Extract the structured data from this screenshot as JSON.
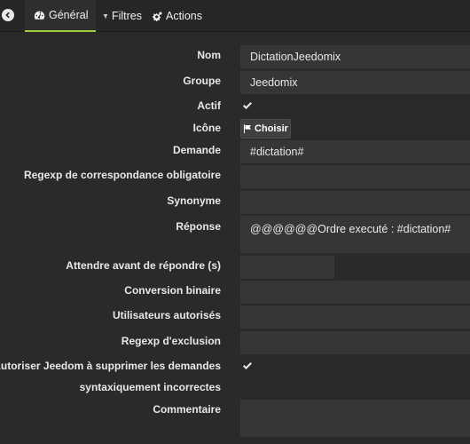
{
  "tabs": [
    {
      "label": "Général",
      "icon": "dashboard-icon",
      "active": true
    },
    {
      "label": "Filtres",
      "icon": "filter-icon",
      "active": false
    },
    {
      "label": "Actions",
      "icon": "cogs-icon",
      "active": false
    }
  ],
  "form": {
    "nom": {
      "label": "Nom",
      "value": "DictationJeedomix"
    },
    "groupe": {
      "label": "Groupe",
      "value": "Jeedomix"
    },
    "actif": {
      "label": "Actif",
      "checked": true
    },
    "icone": {
      "label": "Icône",
      "button_label": "Choisir"
    },
    "demande": {
      "label": "Demande",
      "value": "#dictation#"
    },
    "regexp_correspondance": {
      "label": "Regexp de correspondance obligatoire",
      "value": ""
    },
    "synonyme": {
      "label": "Synonyme",
      "value": ""
    },
    "reponse": {
      "label": "Réponse",
      "value": "@@@@@@Ordre executé : #dictation#"
    },
    "attendre": {
      "label": "Attendre avant de répondre (s)",
      "value": ""
    },
    "conversion": {
      "label": "Conversion binaire",
      "value": ""
    },
    "utilisateurs": {
      "label": "Utilisateurs autorisés",
      "value": ""
    },
    "regexp_exclusion": {
      "label": "Regexp d'exclusion",
      "value": ""
    },
    "autoriser": {
      "label_line1": "Autoriser Jeedom à supprimer les demandes",
      "label_line2": "syntaxiquement incorrectes",
      "checked": true
    },
    "commentaire": {
      "label": "Commentaire",
      "value": ""
    }
  },
  "colors": {
    "accent": "#9ccc3a",
    "background": "#2a2a2a",
    "field": "#363636"
  }
}
